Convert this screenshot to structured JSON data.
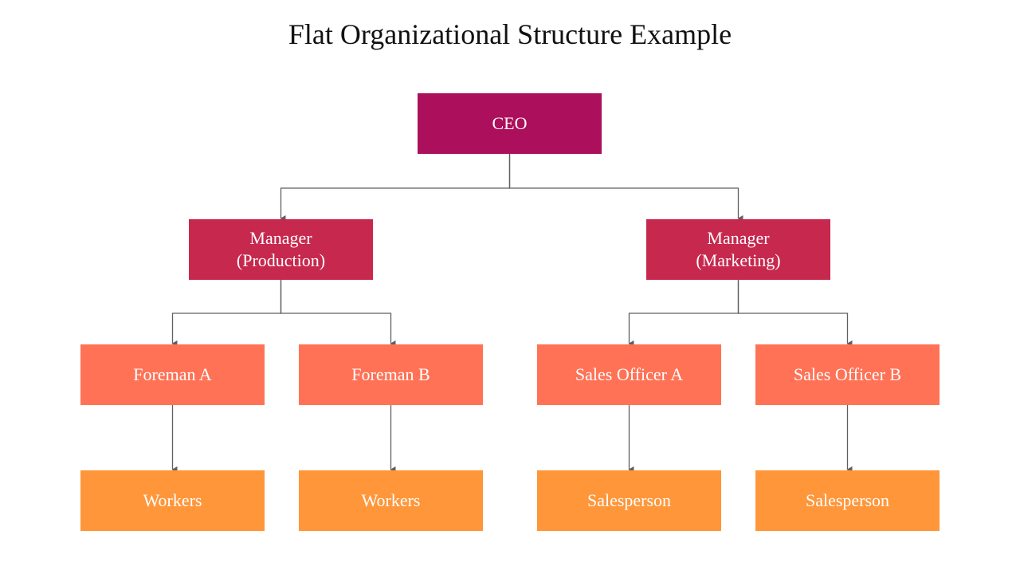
{
  "title": "Flat Organizational Structure Example",
  "colors": {
    "ceo": "#AC0F5B",
    "manager": "#C7284E",
    "level3": "#FF7256",
    "level4": "#FF963A",
    "connector": "#606060"
  },
  "nodes": {
    "ceo": {
      "label": "CEO"
    },
    "manager_production": {
      "label": "Manager\n(Production)"
    },
    "manager_marketing": {
      "label": "Manager\n(Marketing)"
    },
    "foreman_a": {
      "label": "Foreman A"
    },
    "foreman_b": {
      "label": "Foreman B"
    },
    "sales_officer_a": {
      "label": "Sales Officer A"
    },
    "sales_officer_b": {
      "label": "Sales Officer B"
    },
    "workers_a": {
      "label": "Workers"
    },
    "workers_b": {
      "label": "Workers"
    },
    "salesperson_a": {
      "label": "Salesperson"
    },
    "salesperson_b": {
      "label": "Salesperson"
    }
  },
  "edges": [
    [
      "ceo",
      "manager_production"
    ],
    [
      "ceo",
      "manager_marketing"
    ],
    [
      "manager_production",
      "foreman_a"
    ],
    [
      "manager_production",
      "foreman_b"
    ],
    [
      "manager_marketing",
      "sales_officer_a"
    ],
    [
      "manager_marketing",
      "sales_officer_b"
    ],
    [
      "foreman_a",
      "workers_a"
    ],
    [
      "foreman_b",
      "workers_b"
    ],
    [
      "sales_officer_a",
      "salesperson_a"
    ],
    [
      "sales_officer_b",
      "salesperson_b"
    ]
  ]
}
